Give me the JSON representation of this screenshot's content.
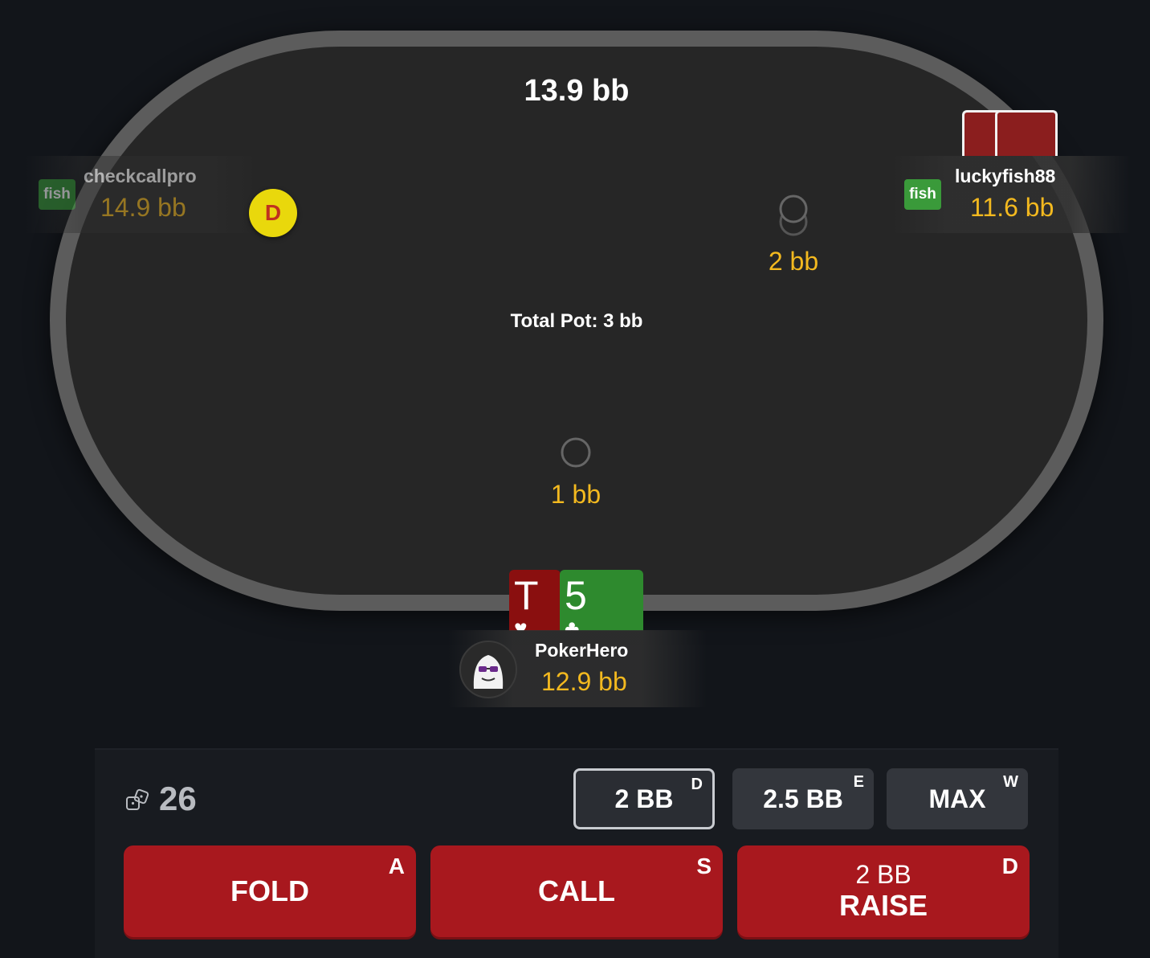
{
  "table": {
    "pot_display": "13.9 bb",
    "total_pot": "Total Pot: 3 bb"
  },
  "players": {
    "left": {
      "tag": "fish",
      "name": "checkcallpro",
      "stack": "14.9 bb",
      "dealer": "D"
    },
    "right": {
      "tag": "fish",
      "name": "luckyfish88",
      "stack": "11.6 bb"
    },
    "hero": {
      "name": "PokerHero",
      "stack": "12.9 bb",
      "cards": [
        {
          "rank": "T",
          "suit": "hearts",
          "suit_glyph": "♥",
          "color": "#8a0f0f"
        },
        {
          "rank": "5",
          "suit": "clubs",
          "suit_glyph": "♣",
          "color": "#2e8a2e"
        }
      ]
    }
  },
  "bets": {
    "right": "2 bb",
    "hero": "1 bb"
  },
  "action_bar": {
    "hand_count": "26",
    "size_buttons": [
      {
        "label": "2 BB",
        "hotkey": "D",
        "active": true
      },
      {
        "label": "2.5 BB",
        "hotkey": "E",
        "active": false
      },
      {
        "label": "MAX",
        "hotkey": "W",
        "active": false
      }
    ],
    "fold": {
      "label": "FOLD",
      "hotkey": "A"
    },
    "call": {
      "label": "CALL",
      "hotkey": "S"
    },
    "raise": {
      "amount": "2 BB",
      "label": "RAISE",
      "hotkey": "D"
    }
  },
  "colors": {
    "accent": "#f3b91f",
    "action_red": "#a8181e",
    "tag_green": "#3a9a3a",
    "dealer_yellow": "#e9d80c"
  }
}
